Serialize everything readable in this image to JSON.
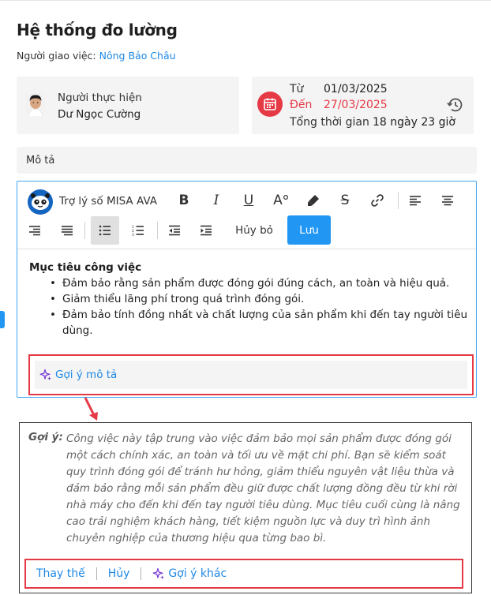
{
  "header": {
    "title": "Hệ thống đo lường",
    "assigner_label": "Người giao việc:",
    "assigner_name": "Nông Bảo Châu"
  },
  "executor": {
    "label": "Người thực hiện",
    "name": "Dư Ngọc Cường"
  },
  "time": {
    "from_label": "Từ",
    "from_value": "01/03/2025",
    "to_label": "Đến",
    "to_value": "27/03/2025",
    "total_label": "Tổng thời gian",
    "total_value": "18 ngày 23 giờ"
  },
  "description": {
    "label": "Mô tả"
  },
  "toolbar": {
    "assistant_label": "Trợ lý số MISA AVA",
    "cancel_label": "Hủy bỏ",
    "save_label": "Lưu",
    "bold": "B",
    "italic": "I",
    "underline": "U",
    "font_size": "A",
    "strike": "S"
  },
  "editor": {
    "heading": "Mục tiêu công việc",
    "bullets": [
      "Đảm bảo rằng sản phẩm được đóng gói đúng cách, an toàn và hiệu quả.",
      "Giảm thiểu lãng phí trong quá trình đóng gói.",
      "Đảm bảo tính đồng nhất và chất lượng của sản phẩm khi đến tay người tiêu dùng."
    ],
    "suggest_label": "Gợi ý mô tả"
  },
  "suggestion": {
    "label": "Gợi ý:",
    "text": "Công việc này tập trung vào việc đảm bảo mọi sản phẩm được đóng gói một cách chính xác, an toàn và tối ưu về mặt chi phí. Bạn sẽ kiểm soát quy trình đóng gói để tránh hư hỏng, giảm thiểu nguyên vật liệu thừa và đảm bảo rằng mỗi sản phẩm đều giữ được chất lượng đồng đều từ khi rời nhà máy cho đến khi đến tay người tiêu dùng. Mục tiêu cuối cùng là nâng cao trải nghiệm khách hàng, tiết kiệm nguồn lực và duy trì hình ảnh chuyên nghiệp của thương hiệu qua từng bao bì.",
    "replace_label": "Thay thế",
    "cancel_label": "Hủy",
    "other_label": "Gợi ý khác"
  },
  "colors": {
    "accent": "#2196f3",
    "link": "#1e88e5",
    "danger": "#e53946",
    "sparkle": "#7b3fd6"
  }
}
